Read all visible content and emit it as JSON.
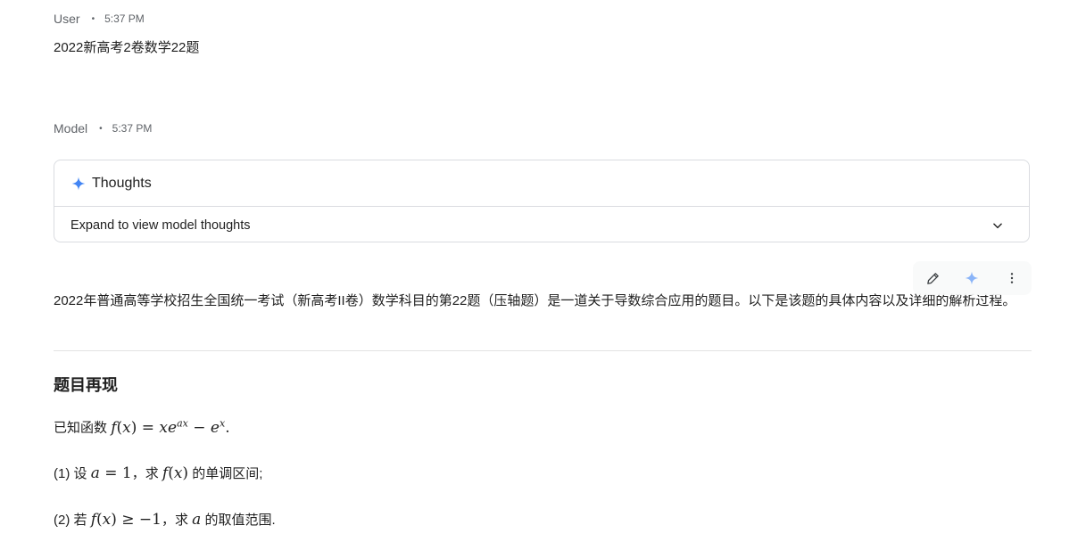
{
  "user": {
    "author": "User",
    "time": "5:37 PM",
    "message": "2022新高考2卷数学22题"
  },
  "model": {
    "author": "Model",
    "time": "5:37 PM",
    "thoughts_title": "Thoughts",
    "thoughts_expand_label": "Expand to view model thoughts",
    "toolbar": {
      "icons": [
        "edit-icon",
        "sparkle-icon",
        "more-vert-icon"
      ]
    },
    "intro": "2022年普通高等学校招生全国统一考试（新高考II卷）数学科目的第22题（压轴题）是一道关于导数综合应用的题目。以下是该题的具体内容以及详细的解析过程。",
    "heading": "题目再现",
    "problem": {
      "line1_prefix": "已知函数",
      "line2_prefix": "(1) 设",
      "line2_mid": "，求",
      "line2_suffix": "的单调区间;",
      "line3_prefix": "(2) 若",
      "line3_mid": "，求",
      "line3_suffix": "的取值范围."
    }
  },
  "colors": {
    "accent": "#4285f4",
    "text": "#1f1f1f",
    "muted": "#5f6368",
    "border": "#dadce0"
  }
}
